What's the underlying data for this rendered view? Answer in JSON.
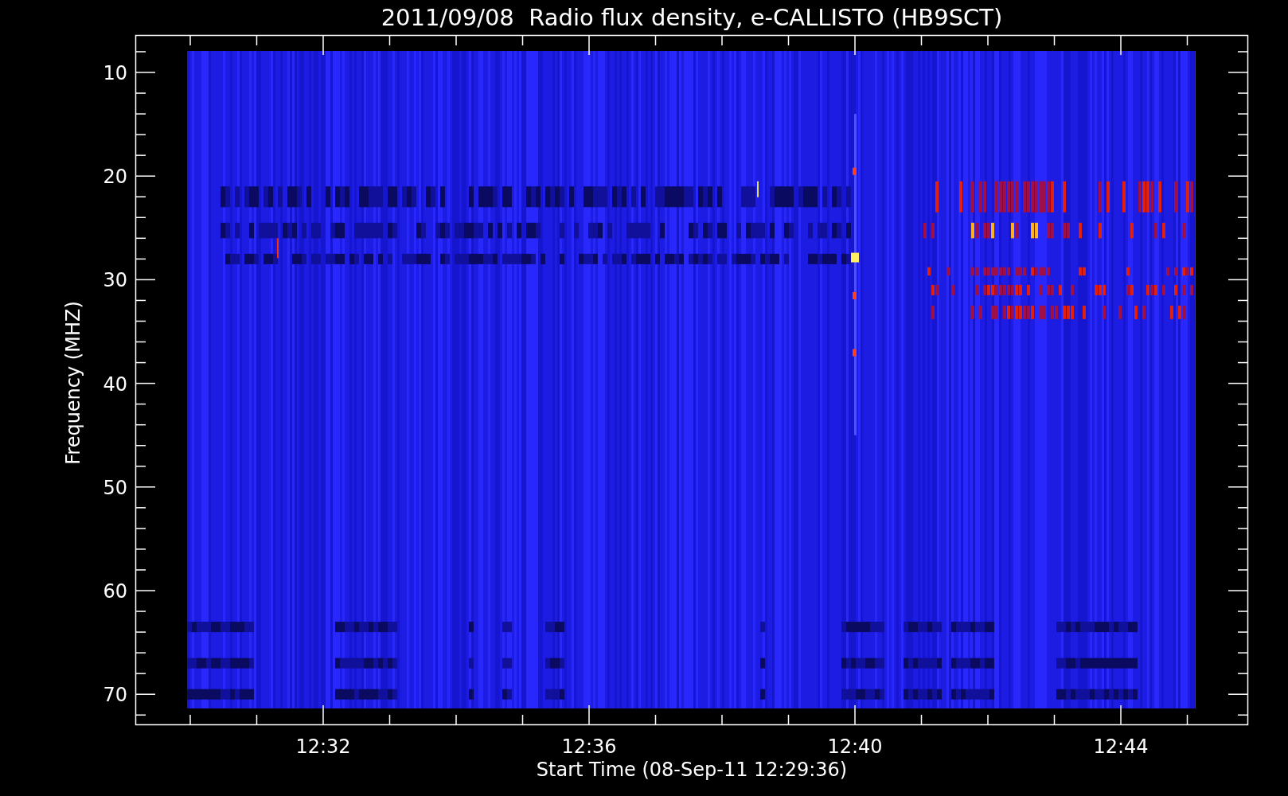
{
  "title": "2011/09/08  Radio flux density, e-CALLISTO (HB9SCT)",
  "y_axis": {
    "label": "Frequency (MHZ)",
    "ticks": [
      "10",
      "20",
      "30",
      "40",
      "50",
      "60",
      "70"
    ]
  },
  "x_axis": {
    "label": "Start Time (08-Sep-11 12:29:36)",
    "ticks": [
      "12:32",
      "12:36",
      "12:40",
      "12:44"
    ]
  }
}
